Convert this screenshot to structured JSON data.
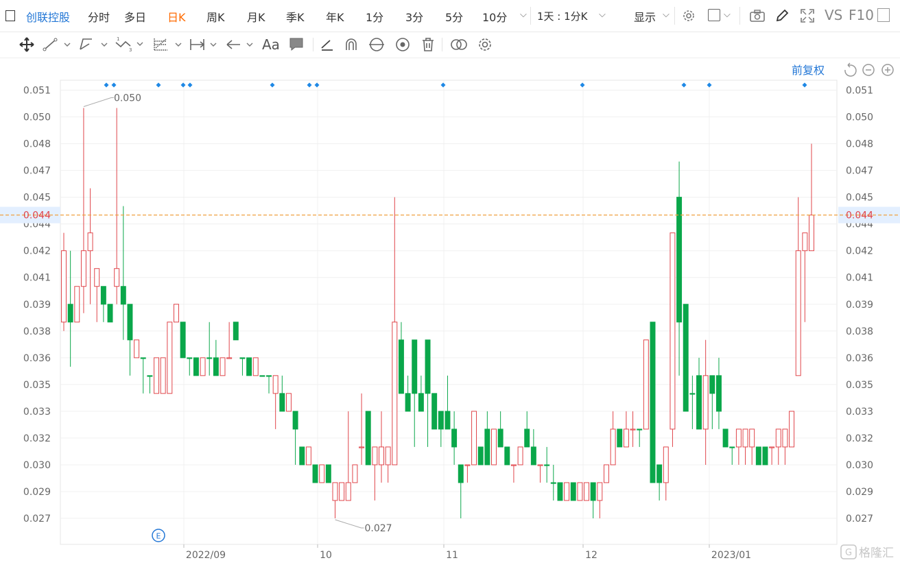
{
  "stock_name": "创联控股",
  "period_tabs": [
    "分时",
    "多日",
    "日K",
    "周K",
    "月K",
    "季K",
    "年K",
    "1分",
    "3分",
    "5分",
    "10分"
  ],
  "active_tab": "日K",
  "interval_select": "1天 : 1分K",
  "display_menu": "显示",
  "vs_label": "VS",
  "f10_label": "F10",
  "adjust_label": "前复权",
  "colors": {
    "up": "#e0454a",
    "down": "#0aa74a",
    "active_tab": "#ff6a00",
    "link": "#2377d6",
    "marker": "#1e88e5",
    "price_line": "#f0a040"
  },
  "y_axis_labels": [
    "0.051",
    "0.050",
    "0.048",
    "0.047",
    "0.045",
    "0.044",
    "0.042",
    "0.041",
    "0.039",
    "0.038",
    "0.036",
    "0.035",
    "0.033",
    "0.032",
    "0.030",
    "0.029",
    "0.027"
  ],
  "x_axis_labels": [
    "2022/09",
    "10",
    "11",
    "12",
    "2023/01"
  ],
  "current_price": "0.044",
  "high_annotation": "0.050",
  "low_annotation": "0.027",
  "event_marker": "E",
  "watermark": "格隆汇",
  "chart_data": {
    "type": "candlestick",
    "x": [
      "2022/09",
      "10",
      "11",
      "12",
      "2023/01"
    ],
    "ylim": [
      0.026,
      0.0515
    ],
    "candles": [
      [
        0.038,
        0.042,
        0.0375,
        0.043,
        "up"
      ],
      [
        0.039,
        0.038,
        0.0355,
        0.042,
        "down"
      ],
      [
        0.038,
        0.04,
        0.038,
        0.04,
        "up"
      ],
      [
        0.04,
        0.042,
        0.0385,
        0.05,
        "up"
      ],
      [
        0.042,
        0.043,
        0.039,
        0.0455,
        "up"
      ],
      [
        0.041,
        0.04,
        0.038,
        0.041,
        "up"
      ],
      [
        0.04,
        0.039,
        0.038,
        0.04,
        "down"
      ],
      [
        0.039,
        0.038,
        0.038,
        0.039,
        "down"
      ],
      [
        0.04,
        0.041,
        0.039,
        0.05,
        "up"
      ],
      [
        0.04,
        0.039,
        0.037,
        0.0445,
        "down"
      ],
      [
        0.039,
        0.037,
        0.035,
        0.039,
        "down"
      ],
      [
        0.036,
        0.037,
        0.0365,
        0.037,
        "up"
      ],
      [
        0.036,
        0.036,
        0.034,
        0.036,
        "down"
      ],
      [
        0.035,
        0.035,
        0.034,
        0.035,
        "down"
      ],
      [
        0.034,
        0.036,
        0.034,
        0.036,
        "up"
      ],
      [
        0.034,
        0.036,
        0.034,
        0.036,
        "up"
      ],
      [
        0.034,
        0.038,
        0.034,
        0.038,
        "up"
      ],
      [
        0.038,
        0.039,
        0.038,
        0.039,
        "up"
      ],
      [
        0.038,
        0.036,
        0.036,
        0.038,
        "down"
      ],
      [
        0.036,
        0.036,
        0.035,
        0.036,
        "down"
      ],
      [
        0.036,
        0.035,
        0.035,
        0.036,
        "down"
      ],
      [
        0.035,
        0.036,
        0.035,
        0.036,
        "up"
      ],
      [
        0.036,
        0.036,
        0.035,
        0.038,
        "down"
      ],
      [
        0.036,
        0.035,
        0.035,
        0.037,
        "down"
      ],
      [
        0.035,
        0.036,
        0.035,
        0.036,
        "up"
      ],
      [
        0.036,
        0.036,
        0.036,
        0.038,
        "up"
      ],
      [
        0.038,
        0.037,
        0.037,
        0.038,
        "down"
      ],
      [
        0.036,
        0.036,
        0.035,
        0.036,
        "down"
      ],
      [
        0.036,
        0.035,
        0.035,
        0.036,
        "down"
      ],
      [
        0.035,
        0.036,
        0.035,
        0.036,
        "up"
      ],
      [
        0.035,
        0.035,
        0.035,
        0.035,
        "down"
      ],
      [
        0.035,
        0.035,
        0.034,
        0.035,
        "down"
      ],
      [
        0.035,
        0.034,
        0.032,
        0.035,
        "up"
      ],
      [
        0.034,
        0.033,
        0.033,
        0.035,
        "down"
      ],
      [
        0.034,
        0.033,
        0.033,
        0.034,
        "up"
      ],
      [
        0.033,
        0.032,
        0.03,
        0.033,
        "down"
      ],
      [
        0.031,
        0.03,
        0.03,
        0.031,
        "down"
      ],
      [
        0.031,
        0.03,
        0.03,
        0.031,
        "up"
      ],
      [
        0.03,
        0.029,
        0.029,
        0.03,
        "down"
      ],
      [
        0.03,
        0.029,
        0.029,
        0.03,
        "up"
      ],
      [
        0.03,
        0.029,
        0.029,
        0.03,
        "down"
      ],
      [
        0.029,
        0.028,
        0.027,
        0.029,
        "up"
      ],
      [
        0.029,
        0.028,
        0.028,
        0.029,
        "up"
      ],
      [
        0.029,
        0.028,
        0.028,
        0.033,
        "up"
      ],
      [
        0.03,
        0.029,
        0.029,
        0.03,
        "up"
      ],
      [
        0.031,
        0.031,
        0.03,
        0.034,
        "up"
      ],
      [
        0.033,
        0.03,
        0.03,
        0.033,
        "down"
      ],
      [
        0.031,
        0.03,
        0.028,
        0.031,
        "up"
      ],
      [
        0.03,
        0.031,
        0.029,
        0.033,
        "up"
      ],
      [
        0.031,
        0.03,
        0.029,
        0.031,
        "up"
      ],
      [
        0.03,
        0.038,
        0.03,
        0.045,
        "up"
      ],
      [
        0.037,
        0.034,
        0.034,
        0.038,
        "down"
      ],
      [
        0.034,
        0.033,
        0.033,
        0.035,
        "down"
      ],
      [
        0.037,
        0.034,
        0.031,
        0.037,
        "down"
      ],
      [
        0.034,
        0.033,
        0.033,
        0.035,
        "down"
      ],
      [
        0.037,
        0.034,
        0.031,
        0.037,
        "down"
      ],
      [
        0.034,
        0.032,
        0.032,
        0.034,
        "down"
      ],
      [
        0.033,
        0.032,
        0.031,
        0.033,
        "down"
      ],
      [
        0.033,
        0.032,
        0.032,
        0.035,
        "down"
      ],
      [
        0.032,
        0.031,
        0.03,
        0.033,
        "down"
      ],
      [
        0.03,
        0.029,
        0.027,
        0.03,
        "down"
      ],
      [
        0.03,
        0.03,
        0.029,
        0.03,
        "up"
      ],
      [
        0.03,
        0.033,
        0.03,
        0.033,
        "up"
      ],
      [
        0.031,
        0.03,
        0.03,
        0.031,
        "down"
      ],
      [
        0.032,
        0.03,
        0.03,
        0.033,
        "down"
      ],
      [
        0.03,
        0.032,
        0.03,
        0.032,
        "up"
      ],
      [
        0.032,
        0.031,
        0.031,
        0.033,
        "down"
      ],
      [
        0.031,
        0.03,
        0.03,
        0.031,
        "down"
      ],
      [
        0.03,
        0.03,
        0.029,
        0.03,
        "up"
      ],
      [
        0.03,
        0.031,
        0.03,
        0.031,
        "up"
      ],
      [
        0.032,
        0.031,
        0.031,
        0.033,
        "down"
      ],
      [
        0.031,
        0.03,
        0.03,
        0.032,
        "down"
      ],
      [
        0.03,
        0.03,
        0.029,
        0.03,
        "up"
      ],
      [
        0.03,
        0.03,
        0.029,
        0.031,
        "down"
      ],
      [
        0.029,
        0.029,
        0.028,
        0.03,
        "down"
      ],
      [
        0.029,
        0.028,
        0.028,
        0.029,
        "down"
      ],
      [
        0.028,
        0.029,
        0.028,
        0.029,
        "up"
      ],
      [
        0.029,
        0.028,
        0.028,
        0.029,
        "down"
      ],
      [
        0.029,
        0.028,
        0.028,
        0.029,
        "up"
      ],
      [
        0.028,
        0.029,
        0.028,
        0.029,
        "up"
      ],
      [
        0.029,
        0.028,
        0.027,
        0.029,
        "down"
      ],
      [
        0.028,
        0.029,
        0.027,
        0.029,
        "up"
      ],
      [
        0.029,
        0.03,
        0.029,
        0.03,
        "up"
      ],
      [
        0.03,
        0.032,
        0.03,
        0.033,
        "up"
      ],
      [
        0.032,
        0.031,
        0.031,
        0.032,
        "down"
      ],
      [
        0.031,
        0.032,
        0.031,
        0.033,
        "up"
      ],
      [
        0.032,
        0.032,
        0.031,
        0.033,
        "up"
      ],
      [
        0.032,
        0.032,
        0.031,
        0.032,
        "down"
      ],
      [
        0.032,
        0.037,
        0.032,
        0.037,
        "up"
      ],
      [
        0.038,
        0.029,
        0.029,
        0.038,
        "down"
      ],
      [
        0.03,
        0.029,
        0.028,
        0.03,
        "down"
      ],
      [
        0.029,
        0.031,
        0.028,
        0.031,
        "up"
      ],
      [
        0.032,
        0.043,
        0.031,
        0.043,
        "up"
      ],
      [
        0.045,
        0.038,
        0.035,
        0.047,
        "down"
      ],
      [
        0.039,
        0.033,
        0.033,
        0.039,
        "down"
      ],
      [
        0.034,
        0.034,
        0.032,
        0.035,
        "down"
      ],
      [
        0.035,
        0.032,
        0.032,
        0.036,
        "down"
      ],
      [
        0.032,
        0.035,
        0.03,
        0.037,
        "up"
      ],
      [
        0.035,
        0.034,
        0.032,
        0.035,
        "down"
      ],
      [
        0.035,
        0.033,
        0.032,
        0.036,
        "down"
      ],
      [
        0.032,
        0.031,
        0.031,
        0.032,
        "down"
      ],
      [
        0.031,
        0.031,
        0.03,
        0.031,
        "down"
      ],
      [
        0.031,
        0.032,
        0.03,
        0.032,
        "up"
      ],
      [
        0.031,
        0.032,
        0.03,
        0.032,
        "up"
      ],
      [
        0.031,
        0.032,
        0.03,
        0.032,
        "up"
      ],
      [
        0.031,
        0.03,
        0.03,
        0.031,
        "down"
      ],
      [
        0.031,
        0.03,
        0.03,
        0.031,
        "down"
      ],
      [
        0.031,
        0.031,
        0.03,
        0.031,
        "up"
      ],
      [
        0.031,
        0.032,
        0.03,
        0.032,
        "up"
      ],
      [
        0.032,
        0.031,
        0.03,
        0.032,
        "up"
      ],
      [
        0.031,
        0.033,
        0.031,
        0.033,
        "up"
      ],
      [
        0.035,
        0.042,
        0.035,
        0.045,
        "up"
      ],
      [
        0.042,
        0.043,
        0.038,
        0.043,
        "up"
      ],
      [
        0.042,
        0.044,
        0.042,
        0.048,
        "up"
      ]
    ]
  }
}
